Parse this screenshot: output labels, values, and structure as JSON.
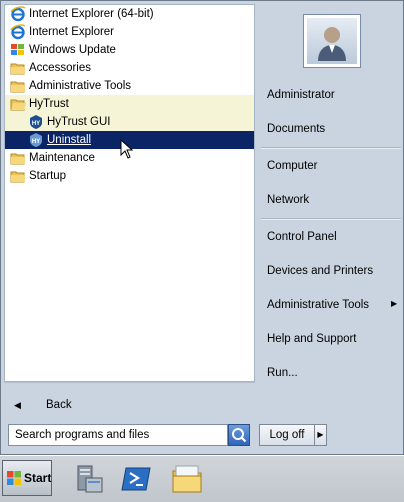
{
  "programs": [
    {
      "label": "Internet Explorer (64-bit)",
      "icon": "internet-explorer-icon"
    },
    {
      "label": "Internet Explorer",
      "icon": "internet-explorer-icon"
    },
    {
      "label": "Windows Update",
      "icon": "windows-update-icon"
    },
    {
      "label": "Accessories",
      "icon": "folder-icon"
    },
    {
      "label": "Administrative Tools",
      "icon": "folder-icon"
    },
    {
      "label": "HyTrust",
      "icon": "folder-icon"
    },
    {
      "label": "HyTrust GUI",
      "icon": "hytrust-icon"
    },
    {
      "label": "Uninstall",
      "icon": "hytrust-icon"
    },
    {
      "label": "Maintenance",
      "icon": "folder-icon"
    },
    {
      "label": "Startup",
      "icon": "folder-icon"
    }
  ],
  "back_label": "Back",
  "search_placeholder": "Search programs and files",
  "right_items": {
    "administrator": "Administrator",
    "documents": "Documents",
    "computer": "Computer",
    "network": "Network",
    "control_panel": "Control Panel",
    "devices_printers": "Devices and Printers",
    "admin_tools": "Administrative Tools",
    "help_support": "Help and Support",
    "run": "Run..."
  },
  "logoff_label": "Log off",
  "start_label": "Start",
  "colors": {
    "selection": "#0a2466",
    "highlight": "#f6f4d6",
    "pane": "#c9d4e0"
  }
}
